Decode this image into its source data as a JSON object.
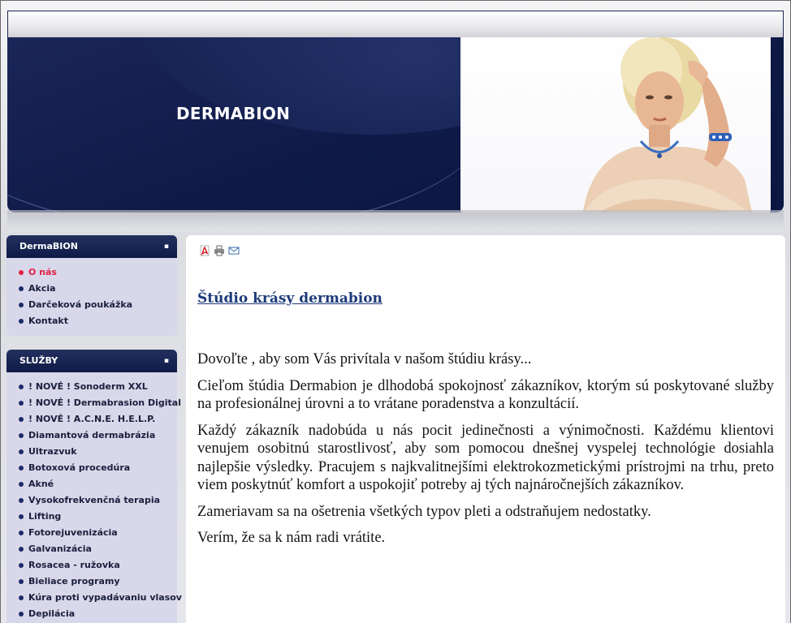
{
  "site": {
    "title": "DERMABION"
  },
  "menus": [
    {
      "heading": "DermaBION",
      "items": [
        {
          "label": "O nás",
          "active": true
        },
        {
          "label": "Akcia",
          "active": false
        },
        {
          "label": "Darčeková poukážka",
          "active": false
        },
        {
          "label": "Kontakt",
          "active": false
        }
      ]
    },
    {
      "heading": "SLUŽBY",
      "items": [
        {
          "label": "! NOVÉ ! Sonoderm XXL"
        },
        {
          "label": "! NOVÉ ! Dermabrasion Digital"
        },
        {
          "label": "! NOVÉ ! A.C.N.E. H.E.L.P."
        },
        {
          "label": "Diamantová dermabrázia"
        },
        {
          "label": "Ultrazvuk"
        },
        {
          "label": "Botoxová procedúra"
        },
        {
          "label": "Akné"
        },
        {
          "label": "Vysokofrekvenčná terapia"
        },
        {
          "label": "Lifting"
        },
        {
          "label": "Fotorejuvenizácia"
        },
        {
          "label": "Galvanizácia"
        },
        {
          "label": "Rosacea - ružovka"
        },
        {
          "label": "Bieliace programy"
        },
        {
          "label": "Kúra proti vypadávaniu vlasov"
        },
        {
          "label": "Depilácia"
        }
      ]
    }
  ],
  "toolbar": {
    "icons": [
      "pdf-icon",
      "print-icon",
      "email-icon"
    ]
  },
  "article": {
    "title": "Štúdio krásy dermabion",
    "paragraphs": [
      "Dovoľte , aby som Vás privítala v našom štúdiu krásy...",
      "Cieľom štúdia Dermabion je dlhodobá spokojnosť zákazníkov, ktorým sú poskytované služby na profesionálnej úrovni a to vrátane poradenstva a konzultácií.",
      "Každý zákazník nadobúda u nás pocit jedinečnosti a výnimočnosti. Každému klientovi venujem osobitnú starostlivosť, aby som pomocou dnešnej vyspelej technológie dosiahla najlepšie výsledky. Pracujem s najkvalitnejšími elektrokozmetickými prístrojmi na trhu, preto viem poskytnúť komfort a uspokojiť potreby aj tých najnáročnejších zákazníkov.",
      "Zameriavam sa na ošetrenia všetkých typov pleti a odstraňujem nedostatky.",
      "Verím, že sa k nám radi vrátite."
    ]
  },
  "colors": {
    "header_navy": "#0f1a48",
    "menu_bg": "#d9d7ea",
    "active_item": "#e0203f",
    "title_link": "#1d3a7a"
  }
}
